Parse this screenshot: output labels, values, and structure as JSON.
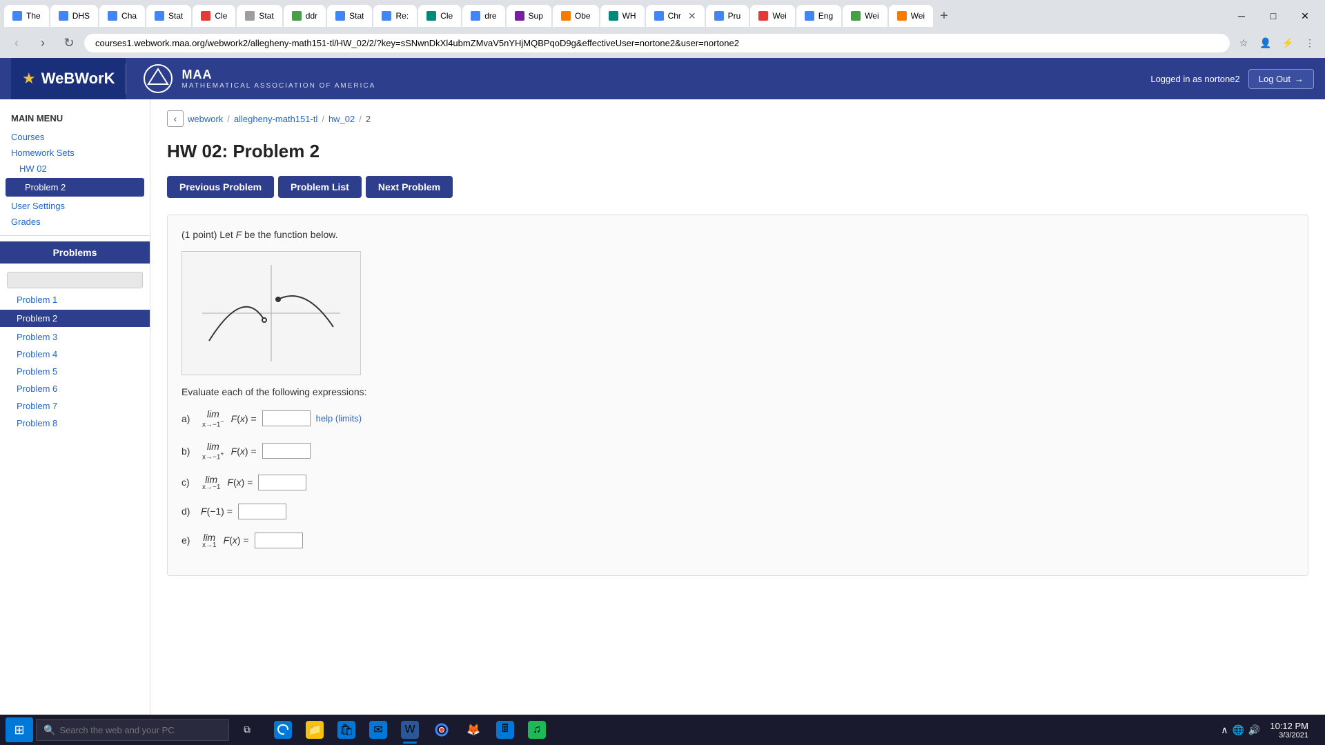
{
  "browser": {
    "url": "courses1.webwork.maa.org/webwork2/allegheny-math151-tl/HW_02/2/?key=sSNwnDkXl4ubmZMvaV5nYHjMQBPqoD9g&effectiveUser=nortone2&user=nortone2",
    "tabs": [
      {
        "label": "The",
        "favicon": "blue",
        "active": false
      },
      {
        "label": "DHS",
        "favicon": "blue",
        "active": false
      },
      {
        "label": "Cha",
        "favicon": "blue",
        "active": false
      },
      {
        "label": "Stat",
        "favicon": "blue",
        "active": false
      },
      {
        "label": "Cle",
        "favicon": "red",
        "active": false
      },
      {
        "label": "Stat",
        "favicon": "gray",
        "active": false
      },
      {
        "label": "ddr",
        "favicon": "green",
        "active": false
      },
      {
        "label": "Stat",
        "favicon": "blue",
        "active": false
      },
      {
        "label": "Re:",
        "favicon": "blue",
        "active": false
      },
      {
        "label": "Cle",
        "favicon": "teal",
        "active": false
      },
      {
        "label": "dre",
        "favicon": "blue",
        "active": false
      },
      {
        "label": "Sup",
        "favicon": "purple",
        "active": false
      },
      {
        "label": "Obe",
        "favicon": "orange",
        "active": false
      },
      {
        "label": "WH",
        "favicon": "teal",
        "active": false
      },
      {
        "label": "Chr",
        "favicon": "blue",
        "active": true
      },
      {
        "label": "Pru",
        "favicon": "blue",
        "active": false
      },
      {
        "label": "Wei",
        "favicon": "red",
        "active": false
      },
      {
        "label": "Eng",
        "favicon": "blue",
        "active": false
      },
      {
        "label": "Wei",
        "favicon": "green",
        "active": false
      },
      {
        "label": "Wei",
        "favicon": "orange",
        "active": false
      }
    ]
  },
  "app": {
    "name": "WeBWorK",
    "maa_title": "MAA",
    "maa_subtitle": "MATHEMATICAL ASSOCIATION OF AMERICA",
    "logged_in_text": "Logged in as nortone2",
    "logout_label": "Log Out"
  },
  "sidebar": {
    "main_menu_label": "MAIN MENU",
    "courses_label": "Courses",
    "homework_sets_label": "Homework Sets",
    "hw02_label": "HW 02",
    "problem2_label": "Problem 2",
    "user_settings_label": "User Settings",
    "grades_label": "Grades",
    "problems_label": "Problems",
    "search_placeholder": "",
    "problem_list": [
      {
        "label": "Problem 1",
        "active": false
      },
      {
        "label": "Problem 2",
        "active": true
      },
      {
        "label": "Problem 3",
        "active": false
      },
      {
        "label": "Problem 4",
        "active": false
      },
      {
        "label": "Problem 5",
        "active": false
      },
      {
        "label": "Problem 6",
        "active": false
      },
      {
        "label": "Problem 7",
        "active": false
      },
      {
        "label": "Problem 8",
        "active": false
      }
    ]
  },
  "breadcrumb": {
    "webwork": "webwork",
    "course": "allegheny-math151-tl",
    "hw": "hw_02",
    "problem": "2"
  },
  "problem": {
    "title": "HW 02: Problem 2",
    "prev_button": "Previous Problem",
    "list_button": "Problem List",
    "next_button": "Next Problem",
    "statement": "(1 point) Let F be the function below.",
    "evaluate_text": "Evaluate each of the following expressions:",
    "parts": [
      {
        "label": "a)",
        "limit_sub": "x→−1⁻",
        "expression": "F(x) =",
        "has_help": true,
        "help_text": "help (limits)"
      },
      {
        "label": "b)",
        "limit_sub": "x→−1⁺",
        "expression": "F(x) =",
        "has_help": false
      },
      {
        "label": "c)",
        "limit_sub": "x→−1",
        "expression": "F(x) =",
        "has_help": false
      },
      {
        "label": "d)",
        "expression": "F(−1) =",
        "is_value": true,
        "has_help": false
      },
      {
        "label": "e)",
        "limit_sub": "x→1",
        "expression": "F(x) =",
        "has_help": false
      }
    ]
  },
  "taskbar": {
    "search_placeholder": "Search the web and your PC",
    "time": "10:12 PM",
    "date": "3/3/2021"
  }
}
